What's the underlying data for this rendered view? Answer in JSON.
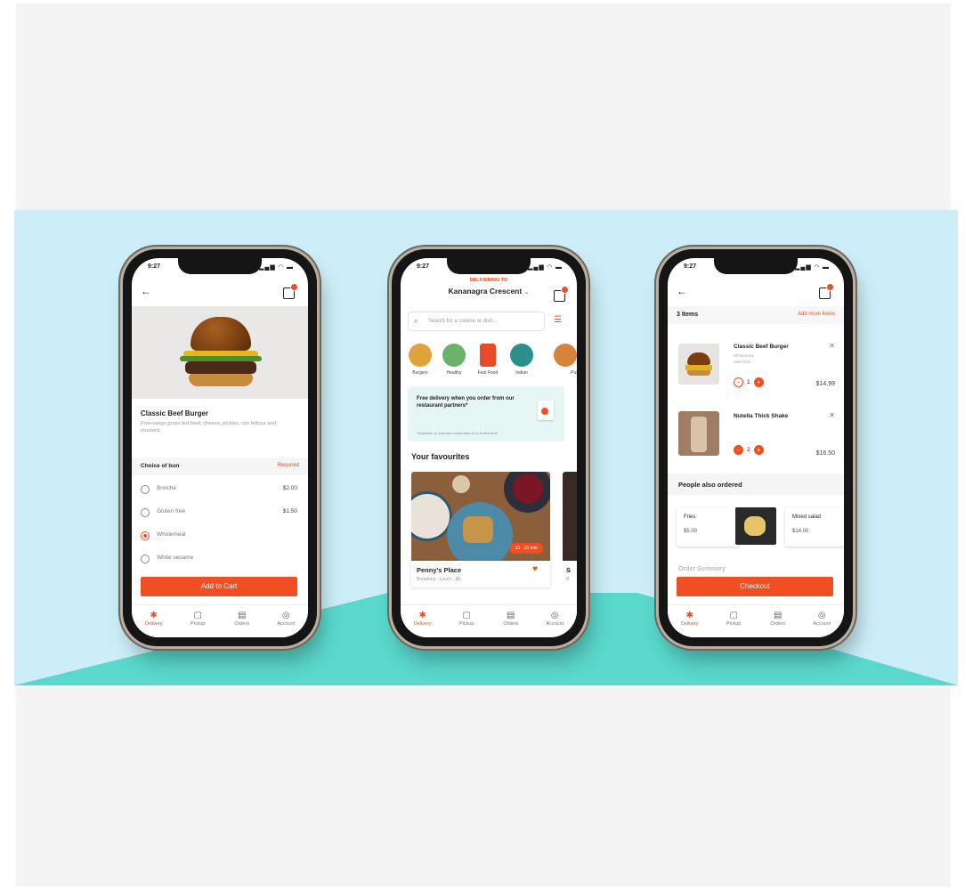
{
  "colors": {
    "accent": "#f04e23",
    "banner_bg": "#cdeef8",
    "floor": "#5ad8cc",
    "outer_bg": "#f4f4f4"
  },
  "status": {
    "time": "9:27",
    "signal": "▂▄▆ ◠ ▬"
  },
  "tabbar": [
    {
      "icon": "delivery-icon",
      "glyph": "✱",
      "label": "Delivery"
    },
    {
      "icon": "pickup-icon",
      "glyph": "▢",
      "label": "Pickup"
    },
    {
      "icon": "orders-icon",
      "glyph": "▤",
      "label": "Orders"
    },
    {
      "icon": "account-icon",
      "glyph": "◎",
      "label": "Account"
    }
  ],
  "product": {
    "back_glyph": "←",
    "title": "Classic Beef Burger",
    "description": "Free-range grass fed beef, cheese, pickles, cos lettuce and mustard.",
    "section_label": "Choice of bun",
    "section_tag": "Required",
    "options": [
      {
        "label": "Brioche",
        "price": "$2.00",
        "selected": false
      },
      {
        "label": "Gluten free",
        "price": "$1.50",
        "selected": false
      },
      {
        "label": "Wholemeal",
        "price": "",
        "selected": true
      },
      {
        "label": "White sesame",
        "price": "",
        "selected": false
      }
    ],
    "add_button": "Add to Cart"
  },
  "home": {
    "delivering_label": "DELIVERING TO",
    "address": "Kananagra Crescent",
    "address_chevron": "⌄",
    "search_icon_glyph": "⌕",
    "search_placeholder": "Search for a cuisine or dish...",
    "filter_glyph": "☰",
    "categories": [
      {
        "label": "Burgers",
        "color": "#e0a23a"
      },
      {
        "label": "Healthy",
        "color": "#6bb36a"
      },
      {
        "label": "Fast Food",
        "color": "#e94a2a"
      },
      {
        "label": "Indian",
        "color": "#2b8f8a"
      },
      {
        "label": "Piz",
        "color": "#d4853a"
      }
    ],
    "promo_title": "Free delivery when you order from our restaurant partners*",
    "promo_note": "*Available on selected restaurants for a limited time",
    "favourites_heading": "Your favourites",
    "restaurant_name": "Penny's Place",
    "restaurant_sub": "Breakfast · Lunch · $$",
    "eta": "10 - 15 min",
    "heart_glyph": "♥",
    "restaurant2_name": "S",
    "restaurant2_sub": "B"
  },
  "cart": {
    "back_glyph": "←",
    "items_label": "3 Items",
    "add_more": "Add more items",
    "items": [
      {
        "name": "Classic Beef Burger",
        "sub": "Wholemeal\nSide Dish",
        "qty": "1",
        "price": "$14.99",
        "remove_glyph": "✕"
      },
      {
        "name": "Nutella Thick Shake",
        "sub": "",
        "qty": "2",
        "price": "$16.50",
        "remove_glyph": "✕"
      }
    ],
    "minus_glyph": "−",
    "plus_glyph": "+",
    "people_heading": "People also ordered",
    "suggestions": [
      {
        "name": "Fries",
        "price": "$5.00"
      },
      {
        "name": "Mixed salad",
        "price": "$14.00"
      }
    ],
    "order_summary": "Order Summary",
    "checkout": "Checkout"
  }
}
